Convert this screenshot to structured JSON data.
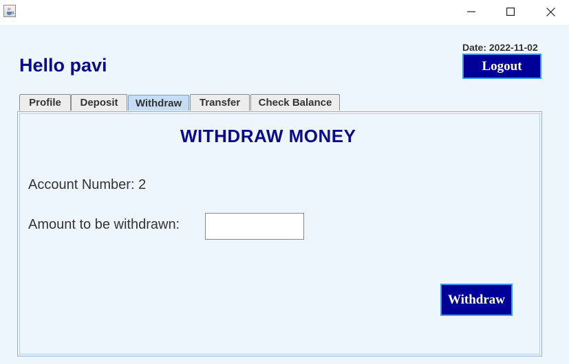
{
  "window": {
    "icon": "java-coffee-icon",
    "controls": [
      "minimize-icon",
      "maximize-icon",
      "close-icon"
    ]
  },
  "header": {
    "greeting": "Hello pavi",
    "date": "Date: 2022-11-02",
    "logout_label": "Logout"
  },
  "tabs": [
    {
      "label": "Profile"
    },
    {
      "label": "Deposit"
    },
    {
      "label": "Withdraw"
    },
    {
      "label": "Transfer"
    },
    {
      "label": "Check Balance"
    }
  ],
  "active_tab": "Withdraw",
  "withdraw_panel": {
    "title": "WITHDRAW MONEY",
    "account_number": "Account Number: 2",
    "amount_label": "Amount to be withdrawn:",
    "amount_value": "",
    "withdraw_label": "Withdraw"
  },
  "colors": {
    "accent_text": "#0a0a8c",
    "button_bg": "#000099",
    "button_border": "#3a9be8",
    "background": "#eef6fd",
    "active_tab": "#c6dcf2"
  }
}
